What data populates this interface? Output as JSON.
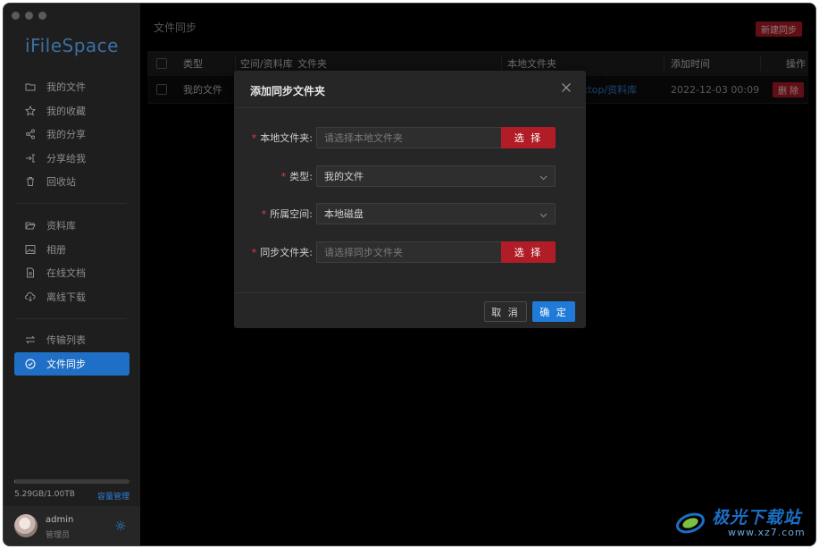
{
  "app": {
    "logo": "iFileSpace"
  },
  "sidebar": {
    "group1": [
      {
        "label": "我的文件",
        "icon": "folder-icon"
      },
      {
        "label": "我的收藏",
        "icon": "star-icon"
      },
      {
        "label": "我的分享",
        "icon": "share-icon"
      },
      {
        "label": "分享给我",
        "icon": "shared-with-me-icon"
      },
      {
        "label": "回收站",
        "icon": "trash-icon"
      }
    ],
    "group2": [
      {
        "label": "资料库",
        "icon": "folder-open-icon"
      },
      {
        "label": "相册",
        "icon": "image-icon"
      },
      {
        "label": "在线文档",
        "icon": "document-icon"
      },
      {
        "label": "离线下载",
        "icon": "cloud-download-icon"
      }
    ],
    "group3": [
      {
        "label": "传输列表",
        "icon": "transfer-icon"
      },
      {
        "label": "文件同步",
        "icon": "sync-check-icon",
        "active": true
      }
    ],
    "storage": {
      "usage_text": "5.29GB/1.00TB",
      "manage_label": "容量管理",
      "used_fraction": 0.005
    },
    "user": {
      "name": "admin",
      "role": "管理员"
    }
  },
  "main": {
    "title": "文件同步",
    "new_button": "新建同步",
    "table": {
      "headers": {
        "type": "类型",
        "space": "空间/资料库",
        "folder": "文件夹",
        "local": "本地文件夹",
        "added": "添加时间",
        "actions": "操作"
      },
      "rows": [
        {
          "type": "我的文件",
          "local_tail": "ktop/资料库",
          "added": "2022-12-03 00:09",
          "delete_label": "删 除"
        }
      ]
    }
  },
  "modal": {
    "title": "添加同步文件夹",
    "fields": {
      "local_folder": {
        "label": "本地文件夹:",
        "placeholder": "请选择本地文件夹",
        "button": "选 择"
      },
      "type": {
        "label": "类型:",
        "value": "我的文件"
      },
      "space": {
        "label": "所属空间:",
        "value": "本地磁盘"
      },
      "sync_folder": {
        "label": "同步文件夹:",
        "placeholder": "请选择同步文件夹",
        "button": "选 择"
      }
    },
    "required_mark": "*",
    "cancel_label": "取 消",
    "ok_label": "确 定"
  },
  "watermark": {
    "text": "极光下载站",
    "url": "www.xz7.com"
  },
  "colors": {
    "accent_blue": "#1f6fc6",
    "danger_red": "#b01d26",
    "sidebar_bg": "#1e1e1e",
    "modal_bg": "#262626"
  }
}
